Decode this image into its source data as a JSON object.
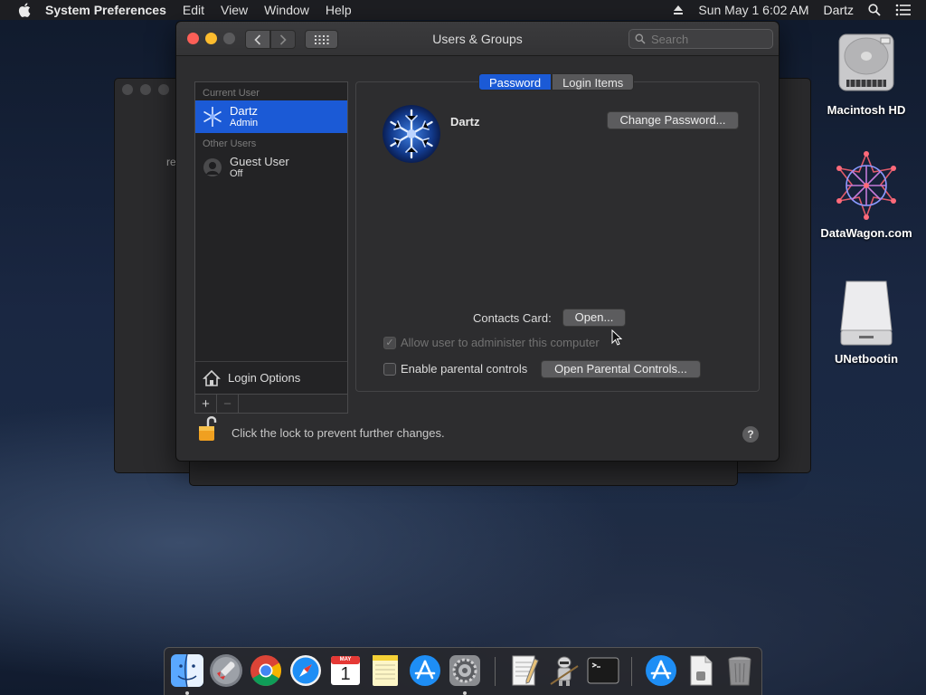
{
  "menubar": {
    "app_name": "System Preferences",
    "menus": [
      "Edit",
      "View",
      "Window",
      "Help"
    ],
    "clock": "Sun May 1  6:02 AM",
    "user": "Dartz"
  },
  "window": {
    "title": "Users & Groups",
    "search_placeholder": "Search"
  },
  "users": {
    "current_header": "Current User",
    "current": {
      "name": "Dartz",
      "role": "Admin"
    },
    "other_header": "Other Users",
    "others": [
      {
        "name": "Guest User",
        "role": "Off"
      }
    ],
    "login_options": "Login Options"
  },
  "tabs": {
    "password": "Password",
    "login_items": "Login Items"
  },
  "panel": {
    "username": "Dartz",
    "change_password": "Change Password...",
    "contacts_label": "Contacts Card:",
    "open": "Open...",
    "allow_admin": "Allow user to administer this computer",
    "parental_controls": "Enable parental controls",
    "open_parental": "Open Parental Controls..."
  },
  "footer": {
    "lock_text": "Click the lock to prevent further changes.",
    "help": "?"
  },
  "bg_window": {
    "fragment": "re"
  },
  "desktop": {
    "icons": [
      "Macintosh HD",
      "DataWagon.com",
      "UNetbootin"
    ]
  },
  "dock": {
    "items": [
      "Finder",
      "Launchpad",
      "Chrome",
      "Safari",
      "Calendar",
      "Notes",
      "App Store",
      "System Preferences",
      "TextEdit",
      "Automator",
      "Terminal",
      "Downloads",
      "Documents",
      "Trash"
    ],
    "calendar_month": "MAY",
    "calendar_day": "1"
  },
  "colors": {
    "accent": "#1b5ad6",
    "close": "#fc5f57",
    "minimize": "#fdbc2e"
  }
}
